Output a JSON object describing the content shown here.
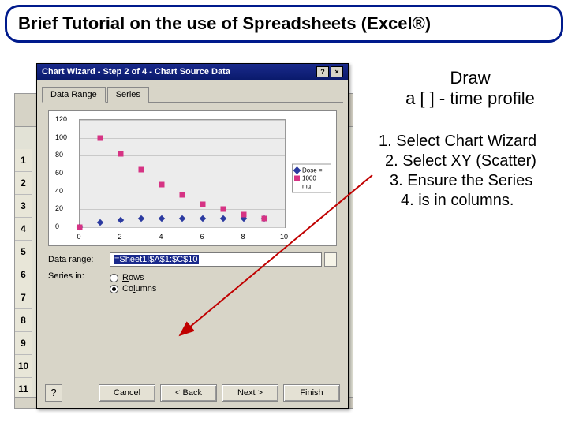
{
  "slide": {
    "title": "Brief Tutorial on the use of Spreadsheets (Excel®)"
  },
  "right": {
    "draw1": "Draw",
    "draw2": "a [ ] - time profile",
    "step1": "1. Select Chart Wizard",
    "step2": "2.  Select XY (Scatter)",
    "step3": "3. Ensure the Series",
    "step4": "4. is in columns."
  },
  "sheet": {
    "rows": [
      "1",
      "2",
      "3",
      "4",
      "5",
      "6",
      "7",
      "8",
      "9",
      "10",
      "11"
    ]
  },
  "wizard": {
    "title": "Chart Wizard - Step 2 of 4 - Chart Source Data",
    "help_icon": "?",
    "close_icon": "×",
    "tabs": {
      "data_range": "Data Range",
      "series": "Series"
    },
    "range_label": "Data range:",
    "range_value": "=Sheet1!$A$1:$C$10",
    "series_label": "Series in:",
    "rows": "Rows",
    "columns": "Columns",
    "buttons": {
      "help": "?",
      "cancel": "Cancel",
      "back": "< Back",
      "next": "Next >",
      "finish": "Finish"
    }
  },
  "chart_data": {
    "type": "scatter",
    "x": [
      0,
      1,
      2,
      3,
      4,
      5,
      6,
      7,
      8,
      9
    ],
    "series": [
      {
        "name": "Dose =",
        "values": [
          0,
          5,
          8,
          10,
          10,
          10,
          10,
          10,
          10,
          10
        ]
      },
      {
        "name": "1000",
        "values": [
          0,
          100,
          82,
          64,
          48,
          36,
          26,
          20,
          14,
          10
        ]
      }
    ],
    "legend_extra": "mg",
    "xlabel": "",
    "ylabel": "",
    "xlim": [
      0,
      10
    ],
    "ylim": [
      0,
      120
    ],
    "yticks": [
      0,
      20,
      40,
      60,
      80,
      100,
      120
    ],
    "xticks": [
      0,
      2,
      4,
      6,
      8,
      10
    ]
  }
}
